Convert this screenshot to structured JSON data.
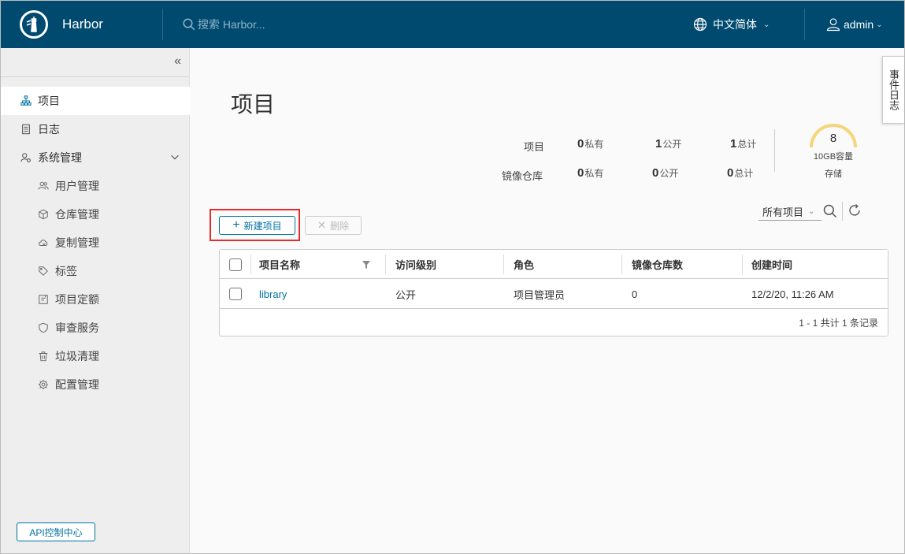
{
  "header": {
    "brand": "Harbor",
    "search_placeholder": "搜索 Harbor...",
    "language": "中文简体",
    "user": "admin"
  },
  "sidebar": {
    "items": [
      {
        "label": "项目",
        "icon": "projects-icon",
        "active": true
      },
      {
        "label": "日志",
        "icon": "log-icon"
      },
      {
        "label": "系统管理",
        "icon": "system-admin-icon",
        "expanded": true
      }
    ],
    "sub_items": [
      {
        "label": "用户管理",
        "icon": "users-icon"
      },
      {
        "label": "仓库管理",
        "icon": "registry-icon"
      },
      {
        "label": "复制管理",
        "icon": "replication-icon"
      },
      {
        "label": "标签",
        "icon": "tag-icon"
      },
      {
        "label": "项目定额",
        "icon": "quota-icon"
      },
      {
        "label": "审查服务",
        "icon": "shield-icon"
      },
      {
        "label": "垃圾清理",
        "icon": "trash-icon"
      },
      {
        "label": "配置管理",
        "icon": "gear-icon"
      }
    ],
    "api_button": "API控制中心"
  },
  "event_tab": "事件日志",
  "page_title": "项目",
  "stats": {
    "row_labels": [
      "项目",
      "镜像仓库"
    ],
    "projects": {
      "private": "0",
      "public": "1",
      "total": "1"
    },
    "repositories": {
      "private": "0",
      "public": "0",
      "total": "0"
    },
    "private_label": "私有",
    "public_label": "公开",
    "total_label": "总计"
  },
  "storage": {
    "value": "8",
    "capacity": "10GB容量",
    "label": "存储"
  },
  "toolbar": {
    "new_project": "新建项目",
    "delete": "删除",
    "filter": "所有项目"
  },
  "table": {
    "columns": [
      "项目名称",
      "访问级别",
      "角色",
      "镜像仓库数",
      "创建时间"
    ],
    "rows": [
      {
        "name": "library",
        "access": "公开",
        "role": "项目管理员",
        "repos": "0",
        "created": "12/2/20, 11:26 AM"
      }
    ],
    "footer": "1 - 1 共计 1 条记录"
  },
  "colors": {
    "header_bg": "#004a70",
    "accent": "#0072a3",
    "highlight": "#e12d2d",
    "gauge": "#f5d67a"
  }
}
